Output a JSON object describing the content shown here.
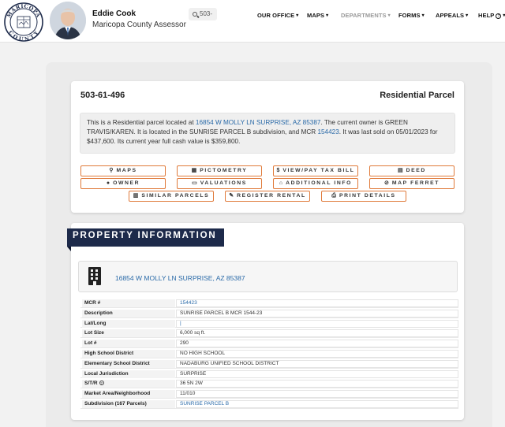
{
  "header": {
    "seal_text_top": "MARICOPA",
    "seal_text_bottom": "COUNTY",
    "official_name": "Eddie Cook",
    "official_title": "Maricopa County Assessor",
    "search_value": "503-",
    "nav": [
      {
        "label": "OUR OFFICE",
        "dim": false
      },
      {
        "label": "MAPS",
        "dim": false
      },
      {
        "label": "DEPARTMENTS",
        "dim": true
      },
      {
        "label": "FORMS",
        "dim": false
      },
      {
        "label": "APPEALS",
        "dim": false
      },
      {
        "label": "HELP",
        "dim": false
      }
    ],
    "help_icon": "question-icon"
  },
  "parcel": {
    "number": "503-61-496",
    "type": "Residential Parcel",
    "summary": {
      "t1": "This is a Residential parcel located at ",
      "address_link": "16854 W MOLLY LN SURPRISE, AZ 85387",
      "t2": ". The current owner is GREEN TRAVIS/KAREN. It is located in the SUNRISE PARCEL B subdivision, and MCR ",
      "mcr_link": "154423",
      "t3": ". It was last sold on 05/01/2023 for $437,600. Its current year full cash value is $359,800."
    }
  },
  "actions": [
    {
      "label": "MAPS",
      "icon": "map-pin-icon",
      "glyph": "⚲"
    },
    {
      "label": "PICTOMETRY",
      "icon": "building-icon",
      "glyph": "▦"
    },
    {
      "label": "VIEW/PAY TAX BILL",
      "icon": "dollar-icon",
      "glyph": "$"
    },
    {
      "label": "DEED",
      "icon": "document-icon",
      "glyph": "▤"
    },
    {
      "label": "OWNER",
      "icon": "user-icon",
      "glyph": "●"
    },
    {
      "label": "VALUATIONS",
      "icon": "money-icon",
      "glyph": "▭"
    },
    {
      "label": "ADDITIONAL INFO",
      "icon": "home-icon",
      "glyph": "⌂"
    },
    {
      "label": "MAP FERRET",
      "icon": "compass-icon",
      "glyph": "⊘"
    },
    {
      "label": "SIMILAR PARCELS",
      "icon": "bar-chart-icon",
      "glyph": "▥"
    },
    {
      "label": "REGISTER RENTAL",
      "icon": "edit-icon",
      "glyph": "✎"
    },
    {
      "label": "PRINT DETAILS",
      "icon": "print-icon",
      "glyph": "⎙"
    }
  ],
  "property_info": {
    "heading": "PROPERTY INFORMATION",
    "address": "16854 W MOLLY LN SURPRISE, AZ 85387",
    "rows": [
      {
        "key": "MCR #",
        "value": "154423",
        "link": true,
        "help": false
      },
      {
        "key": "Description",
        "value": "SUNRISE PARCEL B MCR 1544-23",
        "link": false,
        "help": false
      },
      {
        "key": "Lat/Long",
        "value": "|",
        "link": true,
        "help": false
      },
      {
        "key": "Lot Size",
        "value": "6,000 sq ft.",
        "link": false,
        "help": false
      },
      {
        "key": "Lot #",
        "value": "290",
        "link": false,
        "help": false
      },
      {
        "key": "High School District",
        "value": "NO HIGH SCHOOL",
        "link": false,
        "help": false
      },
      {
        "key": "Elementary School District",
        "value": "NADABURG UNIFIED SCHOOL DISTRICT",
        "link": false,
        "help": false
      },
      {
        "key": "Local Jurisdiction",
        "value": "SURPRISE",
        "link": false,
        "help": false
      },
      {
        "key": "S/T/R",
        "value": "36 5N 2W",
        "link": false,
        "help": true
      },
      {
        "key": "Market Area/Neighborhood",
        "value": "11/010",
        "link": false,
        "help": false
      },
      {
        "key": "Subdivision (167 Parcels)",
        "value": "SUNRISE PARCEL B",
        "link": true,
        "help": false
      }
    ]
  }
}
